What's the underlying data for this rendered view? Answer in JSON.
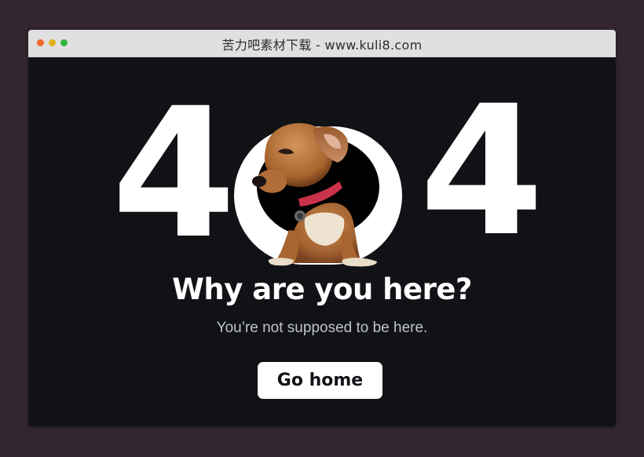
{
  "window": {
    "title": "苦力吧素材下载 - www.kuli8.com"
  },
  "hero": {
    "code_left_digit": "4",
    "code_middle_digit": "0",
    "code_right_digit": "4",
    "illustration": "dachshund-dog"
  },
  "message": {
    "heading": "Why are you here?",
    "subtext": "You’re not supposed to be here."
  },
  "actions": {
    "home_label": "Go home"
  },
  "colors": {
    "page_background": "#33262e",
    "content_background": "#101216",
    "titlebar_background": "#e0e0e0",
    "text_primary": "#ffffff",
    "text_secondary": "#bfc3c8",
    "button_background": "#ffffff",
    "dot_red": "#ef6a2a",
    "dot_yellow": "#e3b21c",
    "dot_green": "#2fb640"
  }
}
